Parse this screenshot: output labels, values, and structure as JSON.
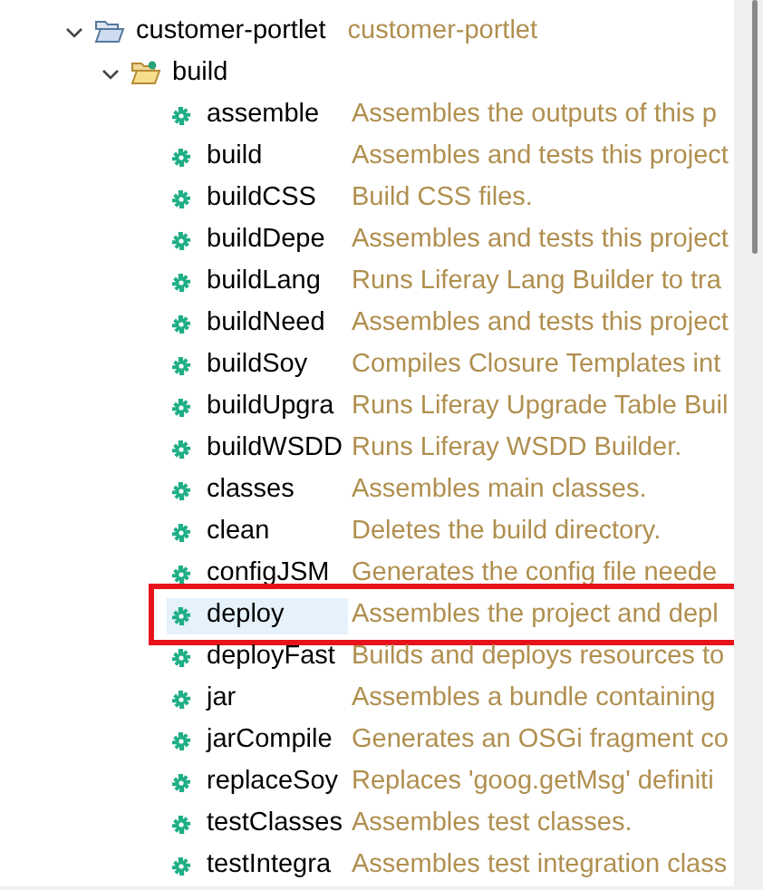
{
  "tree": [
    {
      "label": "customer-portlet",
      "description": "customer-portlet",
      "kind": "project",
      "expanded": true,
      "children": [
        {
          "label": "build",
          "kind": "folder",
          "expanded": true,
          "children": [
            {
              "label": "assemble",
              "description": "Assembles the outputs of this p",
              "kind": "task",
              "selected": false,
              "highlighted": false
            },
            {
              "label": "build",
              "description": "Assembles and tests this project",
              "kind": "task",
              "selected": false,
              "highlighted": false
            },
            {
              "label": "buildCSS",
              "description": "Build CSS files.",
              "kind": "task",
              "selected": false,
              "highlighted": false
            },
            {
              "label": "buildDepe",
              "description": "Assembles and tests this project",
              "kind": "task",
              "selected": false,
              "highlighted": false
            },
            {
              "label": "buildLang",
              "description": "Runs Liferay Lang Builder to tra",
              "kind": "task",
              "selected": false,
              "highlighted": false
            },
            {
              "label": "buildNeed",
              "description": "Assembles and tests this project",
              "kind": "task",
              "selected": false,
              "highlighted": false
            },
            {
              "label": "buildSoy",
              "description": "Compiles Closure Templates int",
              "kind": "task",
              "selected": false,
              "highlighted": false
            },
            {
              "label": "buildUpgra",
              "description": "Runs Liferay Upgrade Table Buil",
              "kind": "task",
              "selected": false,
              "highlighted": false
            },
            {
              "label": "buildWSDD",
              "description": "Runs Liferay WSDD Builder.",
              "kind": "task",
              "selected": false,
              "highlighted": false
            },
            {
              "label": "classes",
              "description": "Assembles main classes.",
              "kind": "task",
              "selected": false,
              "highlighted": false
            },
            {
              "label": "clean",
              "description": "Deletes the build directory.",
              "kind": "task",
              "selected": false,
              "highlighted": false
            },
            {
              "label": "configJSM",
              "description": "Generates the config file neede",
              "kind": "task",
              "selected": false,
              "highlighted": false
            },
            {
              "label": "deploy",
              "description": "Assembles the project and depl",
              "kind": "task",
              "selected": true,
              "highlighted": true
            },
            {
              "label": "deployFast",
              "description": "Builds and deploys resources to",
              "kind": "task",
              "selected": false,
              "highlighted": false
            },
            {
              "label": "jar",
              "description": "Assembles a bundle containing",
              "kind": "task",
              "selected": false,
              "highlighted": false
            },
            {
              "label": "jarCompile",
              "description": "Generates an OSGi fragment co",
              "kind": "task",
              "selected": false,
              "highlighted": false
            },
            {
              "label": "replaceSoy",
              "description": "Replaces 'goog.getMsg' definiti",
              "kind": "task",
              "selected": false,
              "highlighted": false
            },
            {
              "label": "testClasses",
              "description": "Assembles test classes.",
              "kind": "task",
              "selected": false,
              "highlighted": false
            },
            {
              "label": "testIntegra",
              "description": "Assembles test integration class",
              "kind": "task",
              "selected": false,
              "highlighted": false
            }
          ]
        }
      ]
    }
  ]
}
